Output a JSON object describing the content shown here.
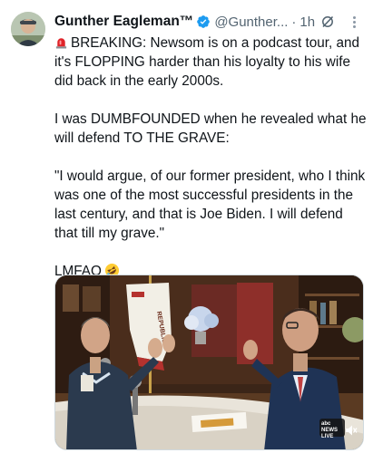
{
  "author": {
    "display_name": "Gunther Eagleman™",
    "handle": "@Gunther...",
    "separator": "·",
    "time": "1h",
    "verified_color": "#1d9bf0"
  },
  "icons": {
    "verified": "verified-badge-icon",
    "grok": "grok-icon",
    "more": "more-options-icon",
    "siren": "police-light-emoji",
    "rofl": "rolling-on-floor-laughing-emoji",
    "mute": "mute-speaker-icon"
  },
  "tweet": {
    "p1": "BREAKING: Newsom is on a podcast tour, and it's FLOPPING harder than his loyalty to his wife did back in the early 2000s.",
    "p2": "I was DUMBFOUNDED when he revealed what he will defend TO THE GRAVE:",
    "p3": "\"I would argue, of our former president, who I think was one of the most successful presidents in the last century, and that is Joe Biden. I will defend that till my grave.\"",
    "p4": "LMFAO"
  },
  "media": {
    "flag_text": "REPUBLIC",
    "badge_line1": "abc",
    "badge_line2": "NEWS LIVE"
  }
}
